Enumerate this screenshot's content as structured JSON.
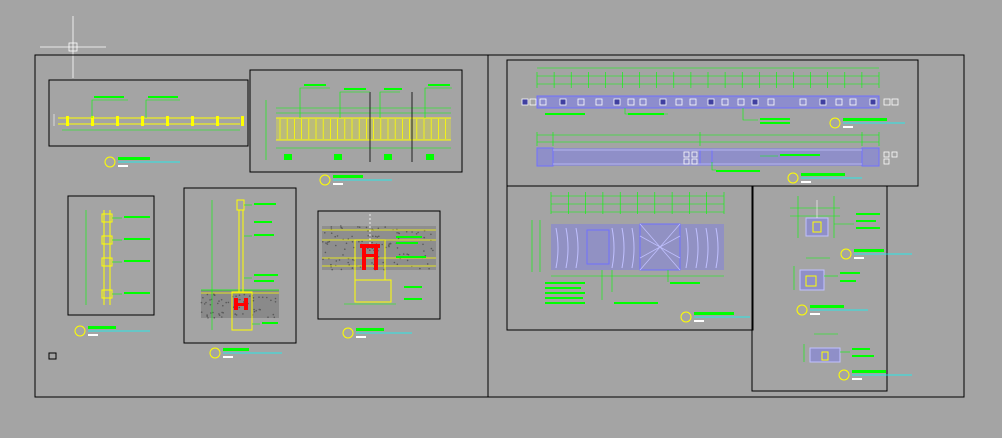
{
  "colors": {
    "background": "#a4a4a4",
    "frame": "#000000",
    "dimension": "#00ff00",
    "wall": "#ffff00",
    "section": "#7070ff",
    "hatch": "#c0c0ff",
    "highlight": "#ff0000",
    "cyan": "#00ffff",
    "tag_fill": "#00ff00",
    "leader": "#ffffff"
  },
  "drawings": {
    "top_elevation": {
      "dim_labels": [
        "",
        ""
      ]
    },
    "panel_plan": {
      "dim_labels": [
        "",
        "",
        "",
        ""
      ]
    }
  },
  "labels": {
    "sheet_left": "",
    "sheet_right": ""
  }
}
